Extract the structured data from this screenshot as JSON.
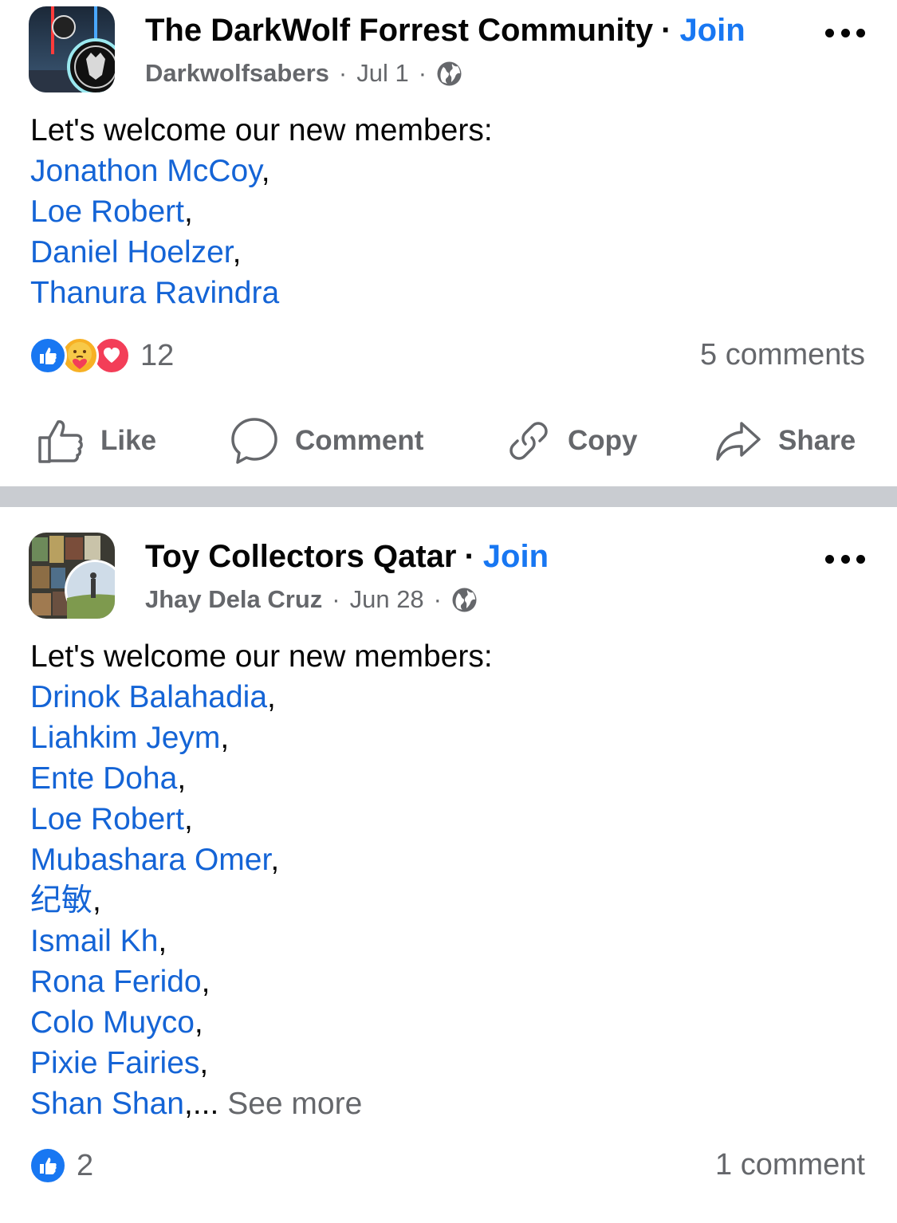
{
  "posts": [
    {
      "group": "The DarkWolf Forrest Community",
      "join_label": "Join",
      "separator": "·",
      "author": "Darkwolfsabers",
      "date": "Jul 1",
      "intro": "Let's welcome our new members:",
      "members": [
        "Jonathon McCoy",
        "Loe Robert",
        "Daniel Hoelzer",
        "Thanura Ravindra"
      ],
      "reaction_count": "12",
      "reactions": [
        "like-icon",
        "care-icon",
        "love-icon"
      ],
      "comments": "5 comments",
      "actions": [
        "Like",
        "Comment",
        "Copy",
        "Share"
      ]
    },
    {
      "group": "Toy Collectors Qatar",
      "join_label": "Join",
      "separator": "·",
      "author": "Jhay Dela Cruz",
      "date": "Jun 28",
      "intro": "Let's welcome our new members:",
      "members": [
        "Drinok Balahadia",
        "Liahkim Jeym",
        "Ente Doha",
        "Loe Robert",
        "Mubashara Omer",
        "纪敏",
        "Ismail Kh",
        "Rona Ferido",
        "Colo Muyco",
        "Pixie Fairies",
        "Shan Shan"
      ],
      "see_more": "See more",
      "truncation": ",...",
      "reaction_count": "2",
      "reactions": [
        "like-icon"
      ],
      "comments": "1 comment"
    }
  ],
  "colors": {
    "link": "#1464d6",
    "join": "#1877f2",
    "secondary_text": "#65676b",
    "divider": "#c9ccd1"
  }
}
